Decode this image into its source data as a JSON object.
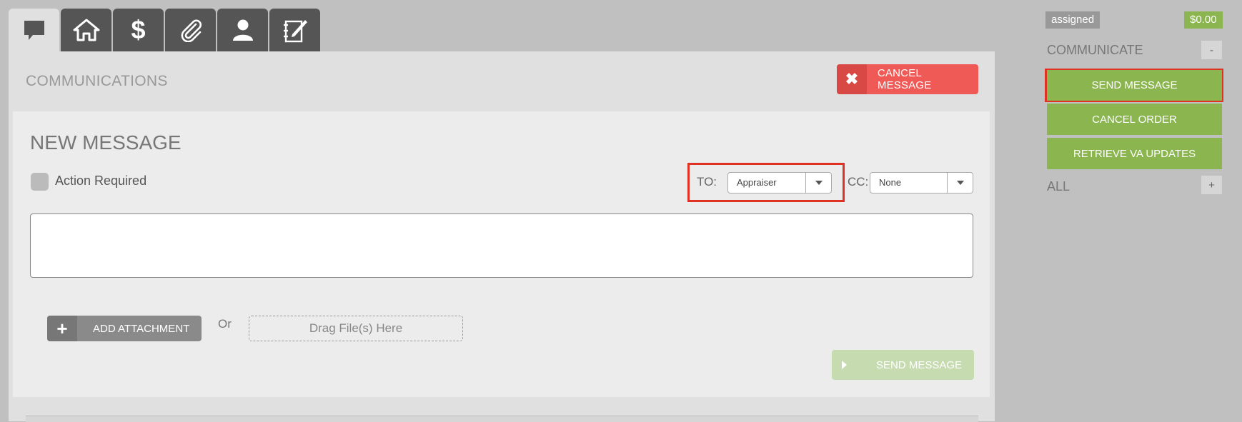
{
  "tabs": [
    {
      "icon": "chat-bubble-icon",
      "active": true
    },
    {
      "icon": "home-icon"
    },
    {
      "icon": "dollar-icon"
    },
    {
      "icon": "paperclip-icon"
    },
    {
      "icon": "user-icon"
    },
    {
      "icon": "notebook-pen-icon"
    }
  ],
  "communications": {
    "title": "COMMUNICATIONS",
    "cancel_label": "CANCEL MESSAGE"
  },
  "new_message": {
    "title": "NEW MESSAGE",
    "action_required_label": "Action Required",
    "to_label": "TO:",
    "to_value": "Appraiser",
    "cc_label": "CC:",
    "cc_value": "None",
    "message_text": "",
    "add_attachment_label": "ADD ATTACHMENT",
    "or_text": "Or",
    "drop_label": "Drag File(s) Here",
    "send_label": "SEND MESSAGE"
  },
  "sidebar": {
    "status": "assigned",
    "amount": "$0.00",
    "communicate_label": "COMMUNICATE",
    "communicate_toggle": "-",
    "actions": [
      {
        "label": "SEND MESSAGE"
      },
      {
        "label": "CANCEL ORDER"
      },
      {
        "label": "RETRIEVE VA UPDATES"
      }
    ],
    "all_label": "ALL",
    "all_toggle": "+"
  },
  "colors": {
    "green": "#8ab54f",
    "red": "#f05a56",
    "highlight": "#e03222",
    "tab_dark": "#555555"
  }
}
